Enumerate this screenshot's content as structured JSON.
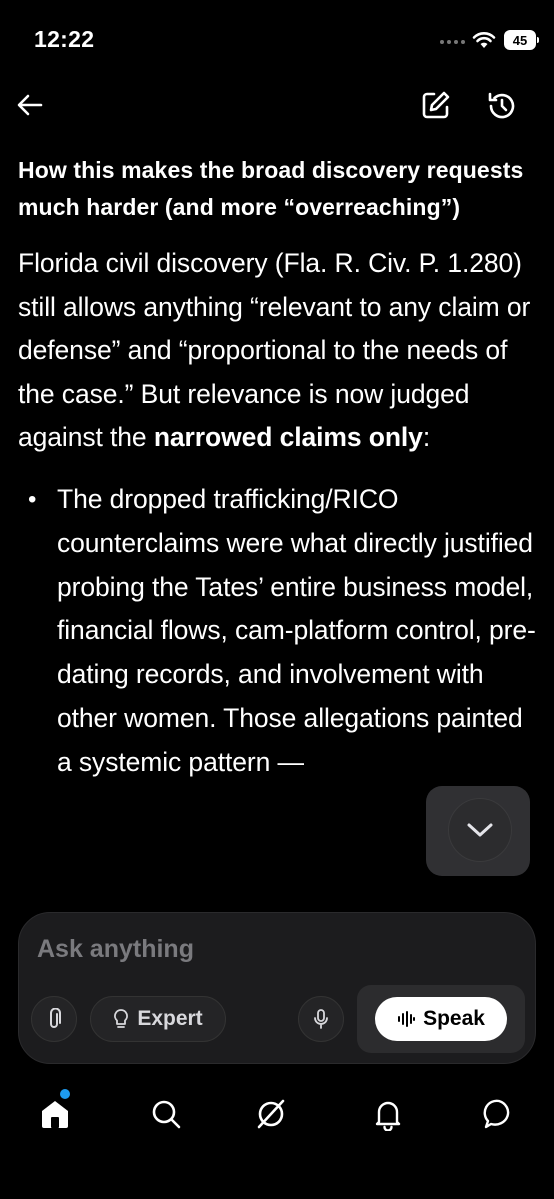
{
  "status_bar": {
    "time": "12:22",
    "battery": "45"
  },
  "header": {
    "back_icon": "arrow-left-icon",
    "edit_icon": "edit-square-icon",
    "history_icon": "history-icon"
  },
  "content": {
    "heading": "How this makes the broad discovery requests much harder (and more “overreaching”)",
    "paragraph_start": "Florida civil discovery (Fla. R. Civ. P. 1.280) still allows anything “relevant to any claim or defense” and “proportional to the needs of the case.” But relevance is now judged against the ",
    "paragraph_bold": "narrowed claims only",
    "paragraph_end": ":",
    "bullets": [
      "The dropped trafficking/RICO counterclaims were what directly justified probing the Tates’ entire business model, financial flows, cam-platform control, pre-dating records, and involvement with other women. Those allegations painted a systemic pattern —"
    ]
  },
  "composer": {
    "placeholder": "Ask anything",
    "expert_label": "Expert",
    "speak_label": "Speak"
  },
  "tab_bar": {
    "items": [
      "home-icon",
      "search-icon",
      "grok-icon",
      "notifications-icon",
      "messages-icon"
    ],
    "accent": "#1d9bf0"
  }
}
